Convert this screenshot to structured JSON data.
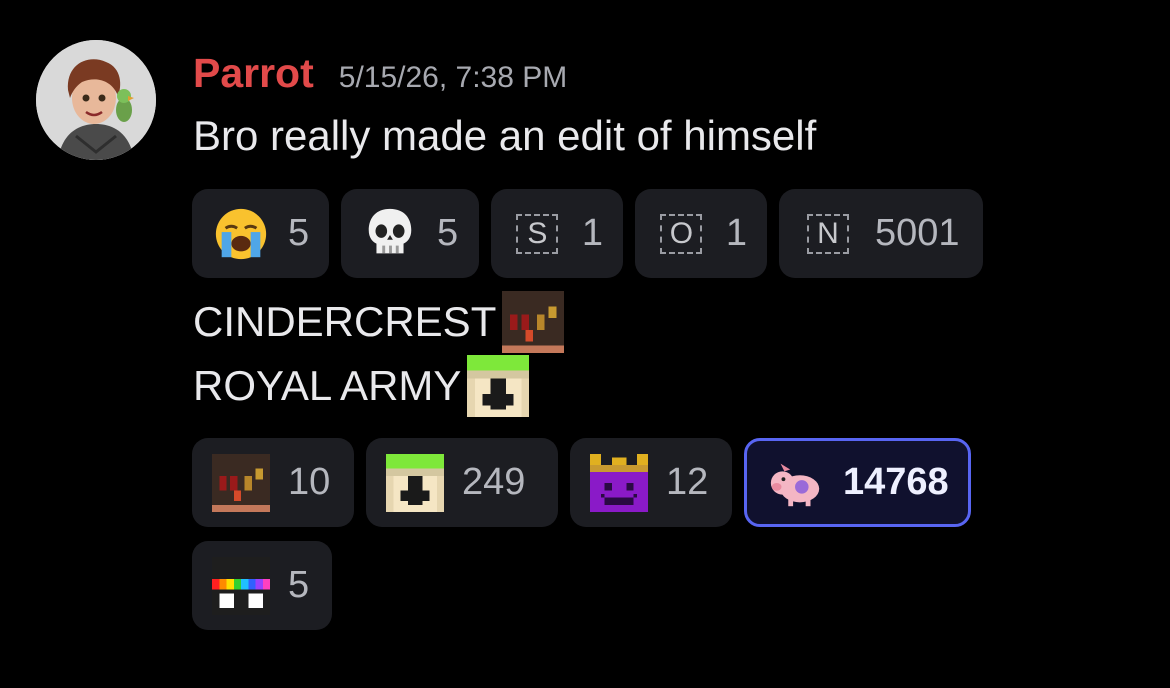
{
  "message": {
    "username": "Parrot",
    "timestamp": "5/15/26, 7:38 PM",
    "text": "Bro really made an edit of himself",
    "username_color": "#e24a4a",
    "avatar_icon": "user-avatar-icon"
  },
  "reactions_top": [
    {
      "emoji": "loudly-crying-face-icon",
      "count": "5"
    },
    {
      "emoji": "skull-icon",
      "count": "5"
    },
    {
      "emoji": "regional-indicator-s-icon",
      "letter": "S",
      "count": "1"
    },
    {
      "emoji": "regional-indicator-o-icon",
      "letter": "O",
      "count": "1"
    },
    {
      "emoji": "regional-indicator-n-icon",
      "letter": "N",
      "count": "5001"
    }
  ],
  "body": {
    "line1": "CINDERCREST",
    "line1_emoji": "cindercrest-emblem-icon",
    "line2": "ROYAL ARMY",
    "line2_emoji": "royal-army-emblem-icon"
  },
  "reactions_bottom": [
    {
      "emoji": "cindercrest-emblem-icon",
      "count": "10"
    },
    {
      "emoji": "royal-army-emblem-icon",
      "count": "249"
    },
    {
      "emoji": "purple-crown-face-icon",
      "count": "12"
    },
    {
      "emoji": "pink-pig-icon",
      "count": "14768",
      "selected": true
    }
  ],
  "reactions_extra": [
    {
      "emoji": "rainbow-glasses-icon",
      "count": "5"
    }
  ],
  "colors": {
    "background": "#000000",
    "reaction_bg": "#1c1d22",
    "selected_border": "#5865f2"
  }
}
